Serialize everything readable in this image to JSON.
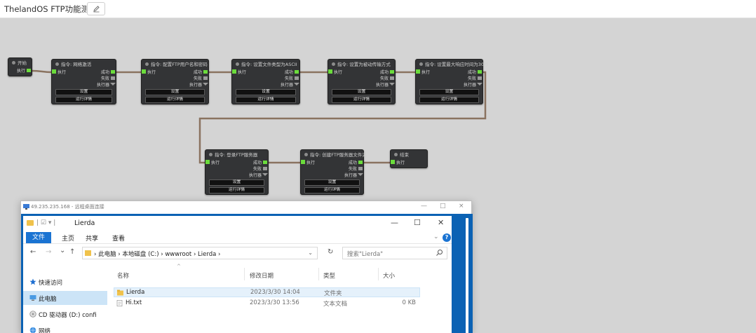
{
  "app": {
    "title": "ThelandOS FTP功能测试",
    "edit_icon": "pencil-icon"
  },
  "flow": {
    "start_node": {
      "title": "开始",
      "output": "执行"
    },
    "end_node": {
      "title": "结束",
      "input": "执行"
    },
    "commands": [
      {
        "title": "指令: 网络激活",
        "input": "执行",
        "outputs": [
          "成功",
          "失败",
          "执行器"
        ],
        "buttons": [
          "设置",
          "运行详情"
        ]
      },
      {
        "title": "指令: 配置FTP用户名和密码",
        "input": "执行",
        "outputs": [
          "成功",
          "失败",
          "执行器"
        ],
        "buttons": [
          "设置",
          "运行详情"
        ]
      },
      {
        "title": "指令: 设置文件类型为ASCII",
        "input": "执行",
        "outputs": [
          "成功",
          "失败",
          "执行器"
        ],
        "buttons": [
          "设置",
          "运行详情"
        ]
      },
      {
        "title": "指令: 设置为被动传输方式",
        "input": "执行",
        "outputs": [
          "成功",
          "失败",
          "执行器"
        ],
        "buttons": [
          "设置",
          "运行详情"
        ]
      },
      {
        "title": "指令: 设置最大响应时间为30秒",
        "input": "执行",
        "outputs": [
          "成功",
          "失败",
          "执行器"
        ],
        "buttons": [
          "设置",
          "运行详情"
        ]
      },
      {
        "title": "指令: 登录FTP服务器",
        "input": "执行",
        "outputs": [
          "成功",
          "失败",
          "执行器"
        ],
        "buttons": [
          "设置",
          "运行详情"
        ]
      },
      {
        "title": "指令: 创建FTP服务器文件夹",
        "input": "执行",
        "outputs": [
          "成功",
          "失败",
          "执行器"
        ],
        "buttons": [
          "设置",
          "运行详情"
        ]
      }
    ],
    "colors": {
      "node_bg": "#333436",
      "port_active": "#6bdc3c",
      "wire": "#8a7360",
      "canvas_bg": "#d4d4d4"
    }
  },
  "remote_desktop": {
    "title": "49.235.235.168 - 远程桌面连接",
    "controls": [
      "—",
      "□",
      "×"
    ]
  },
  "explorer": {
    "quick_access": "| ☑ ▾ |",
    "window_name": "Lierda",
    "window_controls": [
      "—",
      "☐",
      "✕"
    ],
    "ribbon": {
      "file_tab": "文件",
      "tabs": [
        "主页",
        "共享",
        "查看"
      ],
      "help": "?"
    },
    "nav_buttons": [
      "←",
      "→",
      "⌄",
      "↑"
    ],
    "breadcrumbs": "›  此电脑  ›  本地磁盘 (C:)  ›  wwwroot  ›  Lierda  ›",
    "search_placeholder": "搜索\"Lierda\"",
    "nav_pane": [
      {
        "label": "快速访问",
        "icon": "star-icon"
      },
      {
        "label": "此电脑",
        "icon": "computer-icon",
        "selected": true
      },
      {
        "label": "CD 驱动器 (D:) confi",
        "icon": "cd-drive-icon"
      },
      {
        "label": "网络",
        "icon": "network-icon"
      }
    ],
    "columns": [
      "名称",
      "修改日期",
      "类型",
      "大小"
    ],
    "files": [
      {
        "name": "Lierda",
        "modified": "2023/3/30 14:04",
        "type": "文件夹",
        "size": "",
        "icon": "folder-icon",
        "selected": true
      },
      {
        "name": "Hi.txt",
        "modified": "2023/3/30 13:56",
        "type": "文本文档",
        "size": "0 KB",
        "icon": "text-file-icon",
        "selected": false
      }
    ]
  }
}
